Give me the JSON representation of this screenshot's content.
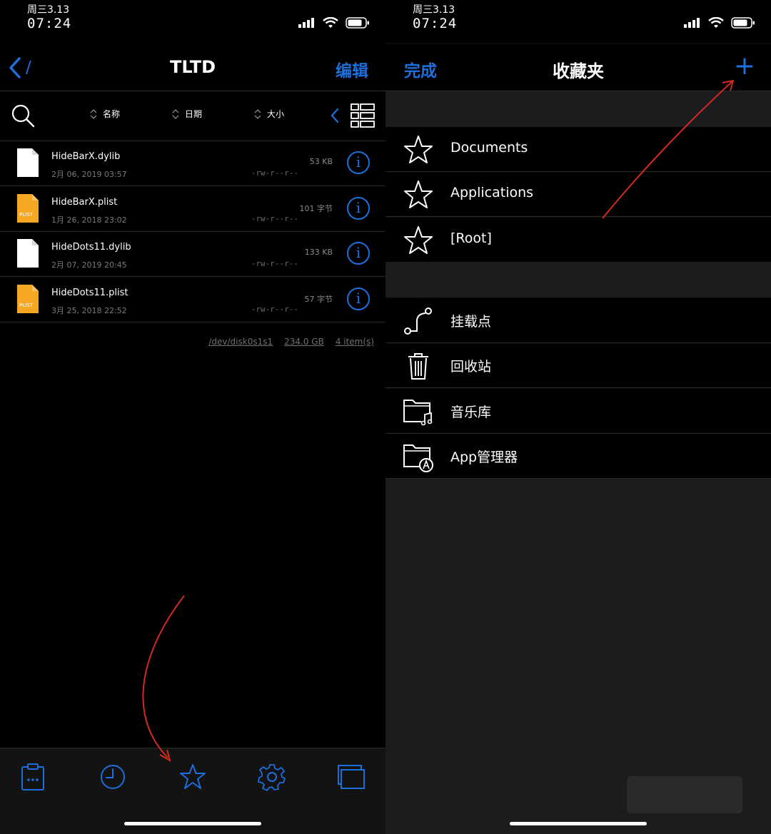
{
  "left": {
    "status": {
      "date": "周三3.13",
      "time": "07:24"
    },
    "nav": {
      "back_label": "/",
      "title": "TLTD",
      "edit_label": "编辑"
    },
    "sort": {
      "name_label": "名称",
      "date_label": "日期",
      "size_label": "大小"
    },
    "files": [
      {
        "name": "HideBarX.dylib",
        "date": "2月 06, 2019 03:57",
        "size": "53 KB",
        "perm": "-rw-r--r--",
        "icon": "file-icon"
      },
      {
        "name": "HideBarX.plist",
        "date": "1月 26, 2018 23:02",
        "size": "101 字节",
        "perm": "-rw-r--r--",
        "icon": "plist-icon"
      },
      {
        "name": "HideDots11.dylib",
        "date": "2月 07, 2019 20:45",
        "size": "133 KB",
        "perm": "-rw-r--r--",
        "icon": "file-icon"
      },
      {
        "name": "HideDots11.plist",
        "date": "3月 25, 2018 22:52",
        "size": "57 字节",
        "perm": "-rw-r--r--",
        "icon": "plist-icon"
      }
    ],
    "plist_badge": "PLIST",
    "footer": {
      "disk": "/dev/disk0s1s1",
      "capacity": "234.0 GB",
      "items": "4 item(s)"
    },
    "tabs": [
      "clipboard-icon",
      "clock-icon",
      "star-icon",
      "gear-icon",
      "windows-icon"
    ]
  },
  "right": {
    "status": {
      "date": "周三3.13",
      "time": "07:24"
    },
    "nav": {
      "done_label": "完成",
      "title": "收藏夹",
      "add_label": "+"
    },
    "favorites": [
      {
        "label": "Documents",
        "icon": "star-icon"
      },
      {
        "label": "Applications",
        "icon": "star-icon"
      },
      {
        "label": "[Root]",
        "icon": "star-icon"
      }
    ],
    "locations": [
      {
        "label": "挂载点",
        "icon": "mount-point-icon"
      },
      {
        "label": "回收站",
        "icon": "trash-icon"
      },
      {
        "label": "音乐库",
        "icon": "music-folder-icon"
      },
      {
        "label": "App管理器",
        "icon": "app-folder-icon"
      }
    ]
  },
  "colors": {
    "accent": "#1c6fdc",
    "annotation_arrow": "#d12a1f"
  }
}
